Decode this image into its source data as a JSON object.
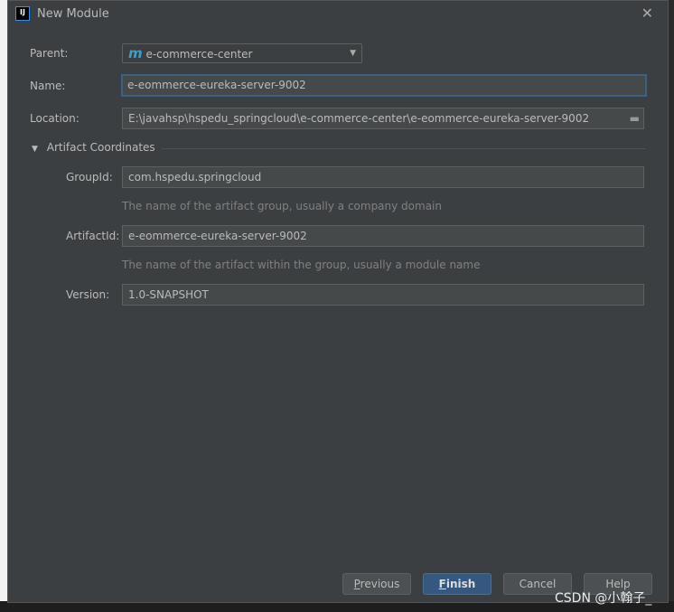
{
  "window": {
    "title": "New Module"
  },
  "form": {
    "parent_label": "Parent:",
    "parent_value": "e-commerce-center",
    "parent_icon": "maven-m-icon",
    "name_label": "Name:",
    "name_value": "e-eommerce-eureka-server-9002",
    "location_label": "Location:",
    "location_value": "E:\\javahsp\\hspedu_springcloud\\e-commerce-center\\e-eommerce-eureka-server-9002",
    "section_title": "Artifact Coordinates",
    "groupid_label": "GroupId:",
    "groupid_value": "com.hspedu.springcloud",
    "groupid_hint": "The name of the artifact group, usually a company domain",
    "artifactid_label": "ArtifactId:",
    "artifactid_value": "e-eommerce-eureka-server-9002",
    "artifactid_hint": "The name of the artifact within the group, usually a module name",
    "version_label": "Version:",
    "version_value": "1.0-SNAPSHOT"
  },
  "buttons": {
    "previous_first": "P",
    "previous_rest": "revious",
    "finish_first": "F",
    "finish_rest": "inish",
    "cancel": "Cancel",
    "help": "Help"
  },
  "watermark": "CSDN @小翰子_",
  "colors": {
    "accent": "#365880",
    "background": "#3c3f41",
    "focus": "#3d6185"
  }
}
